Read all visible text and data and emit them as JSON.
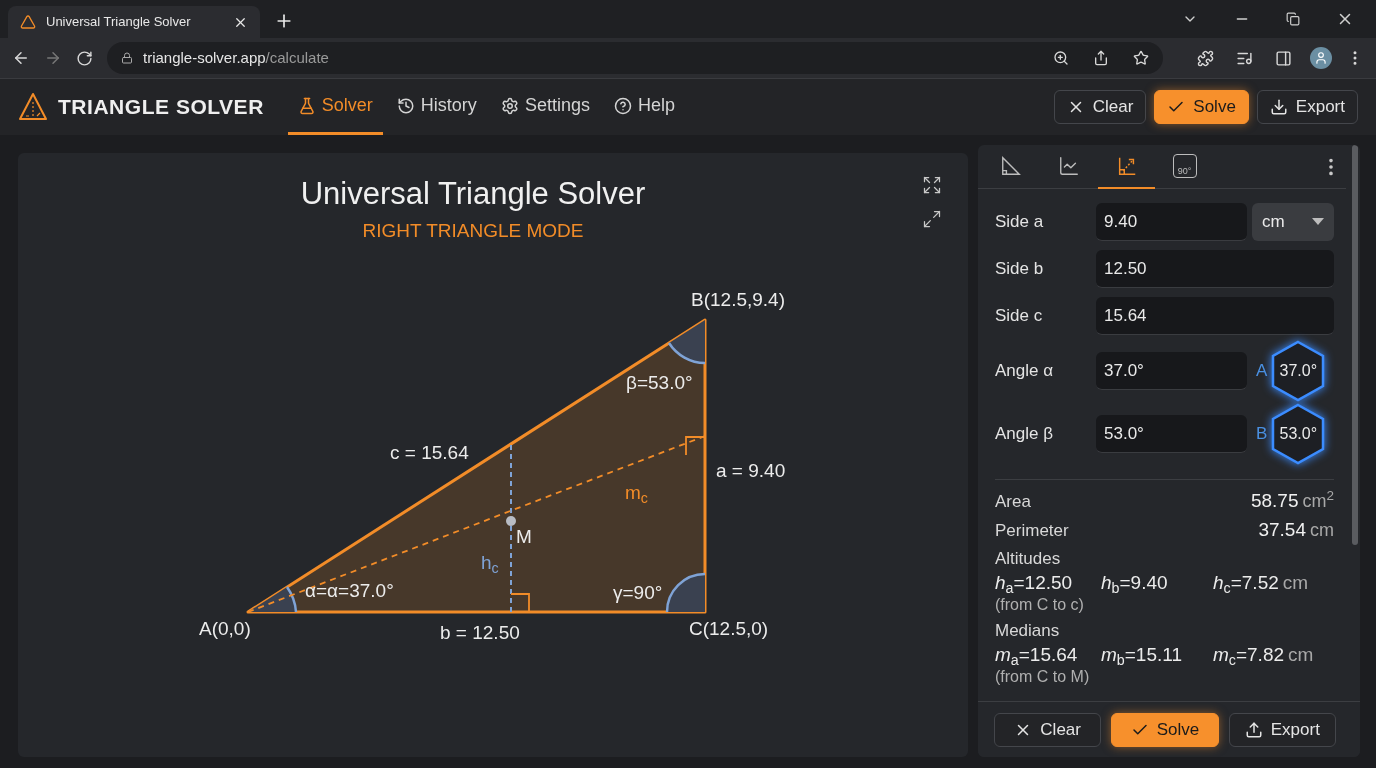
{
  "browser": {
    "tab_title": "Universal Triangle Solver",
    "url_host": "triangle-solver.app",
    "url_path": "/calculate"
  },
  "app": {
    "brand": "TRIANGLE SOLVER",
    "nav": [
      {
        "label": "Solver",
        "kind": "flask",
        "selected": true
      },
      {
        "label": "History",
        "kind": "history",
        "selected": false
      },
      {
        "label": "Settings",
        "kind": "settings",
        "selected": false
      },
      {
        "label": "Help",
        "kind": "help",
        "selected": false
      }
    ],
    "actions": [
      {
        "label": "Clear",
        "kind": "clear"
      },
      {
        "label": "Solve",
        "kind": "solve"
      },
      {
        "label": "Export",
        "kind": "download"
      }
    ]
  },
  "canvas": {
    "title": "Universal Triangle Solver",
    "subtitle": "RIGHT TRIANGLE MODE",
    "vertices": [
      "A(0,0)",
      "B(12.5,9.4)",
      "C(12.5,0)"
    ],
    "sides": [
      "a = 9.40",
      "b = 12.50",
      "c = 15.64"
    ],
    "angles": [
      "α=α=37.0°",
      "β=53.0°",
      "γ=90°"
    ],
    "midpoint": "M",
    "altitude": "h$_{c}$",
    "median": "m$_{c}$"
  },
  "panel": {
    "tabs": [
      {
        "kind": "triangle",
        "selected": false
      },
      {
        "kind": "chart",
        "selected": false
      },
      {
        "kind": "angle",
        "selected": true
      },
      {
        "kind": "rotate",
        "label": "90°",
        "selected": false
      }
    ],
    "inputs": [
      {
        "label": "Side a",
        "value": "9.40",
        "unit": "cm"
      },
      {
        "label": "Side b",
        "value": "12.50"
      },
      {
        "label": "Side c",
        "value": "15.64"
      },
      {
        "label": "Angle α",
        "value": "37.0°",
        "badge_letter": "A",
        "badge_value": "37.0°"
      },
      {
        "label": "Angle β",
        "value": "53.0°",
        "badge_letter": "B",
        "badge_value": "53.0°"
      }
    ],
    "area": {
      "label": "Area",
      "value": "58.75",
      "unit": "cm$^{2}$"
    },
    "perimeter": {
      "label": "Perimeter",
      "value": "37.54",
      "unit": "cm"
    },
    "altitudes": {
      "label": "Altitudes",
      "values": [
        "*h*$_{a}$=12.50",
        "*h*$_{b}$=9.40",
        "*h*$_{c}$=7.52"
      ],
      "unit": "cm",
      "note": "(from C to c)"
    },
    "medians": {
      "label": "Medians",
      "values": [
        "*m*$_{a}$=15.64",
        "*m*$_{b}$=15.11",
        "*m*$_{c}$=7.82"
      ],
      "unit": "cm",
      "note": "(from C to M)"
    },
    "actions": [
      {
        "label": "Clear",
        "kind": "clear"
      },
      {
        "label": "Solve",
        "kind": "solve"
      },
      {
        "label": "Export",
        "kind": "upload"
      }
    ]
  }
}
